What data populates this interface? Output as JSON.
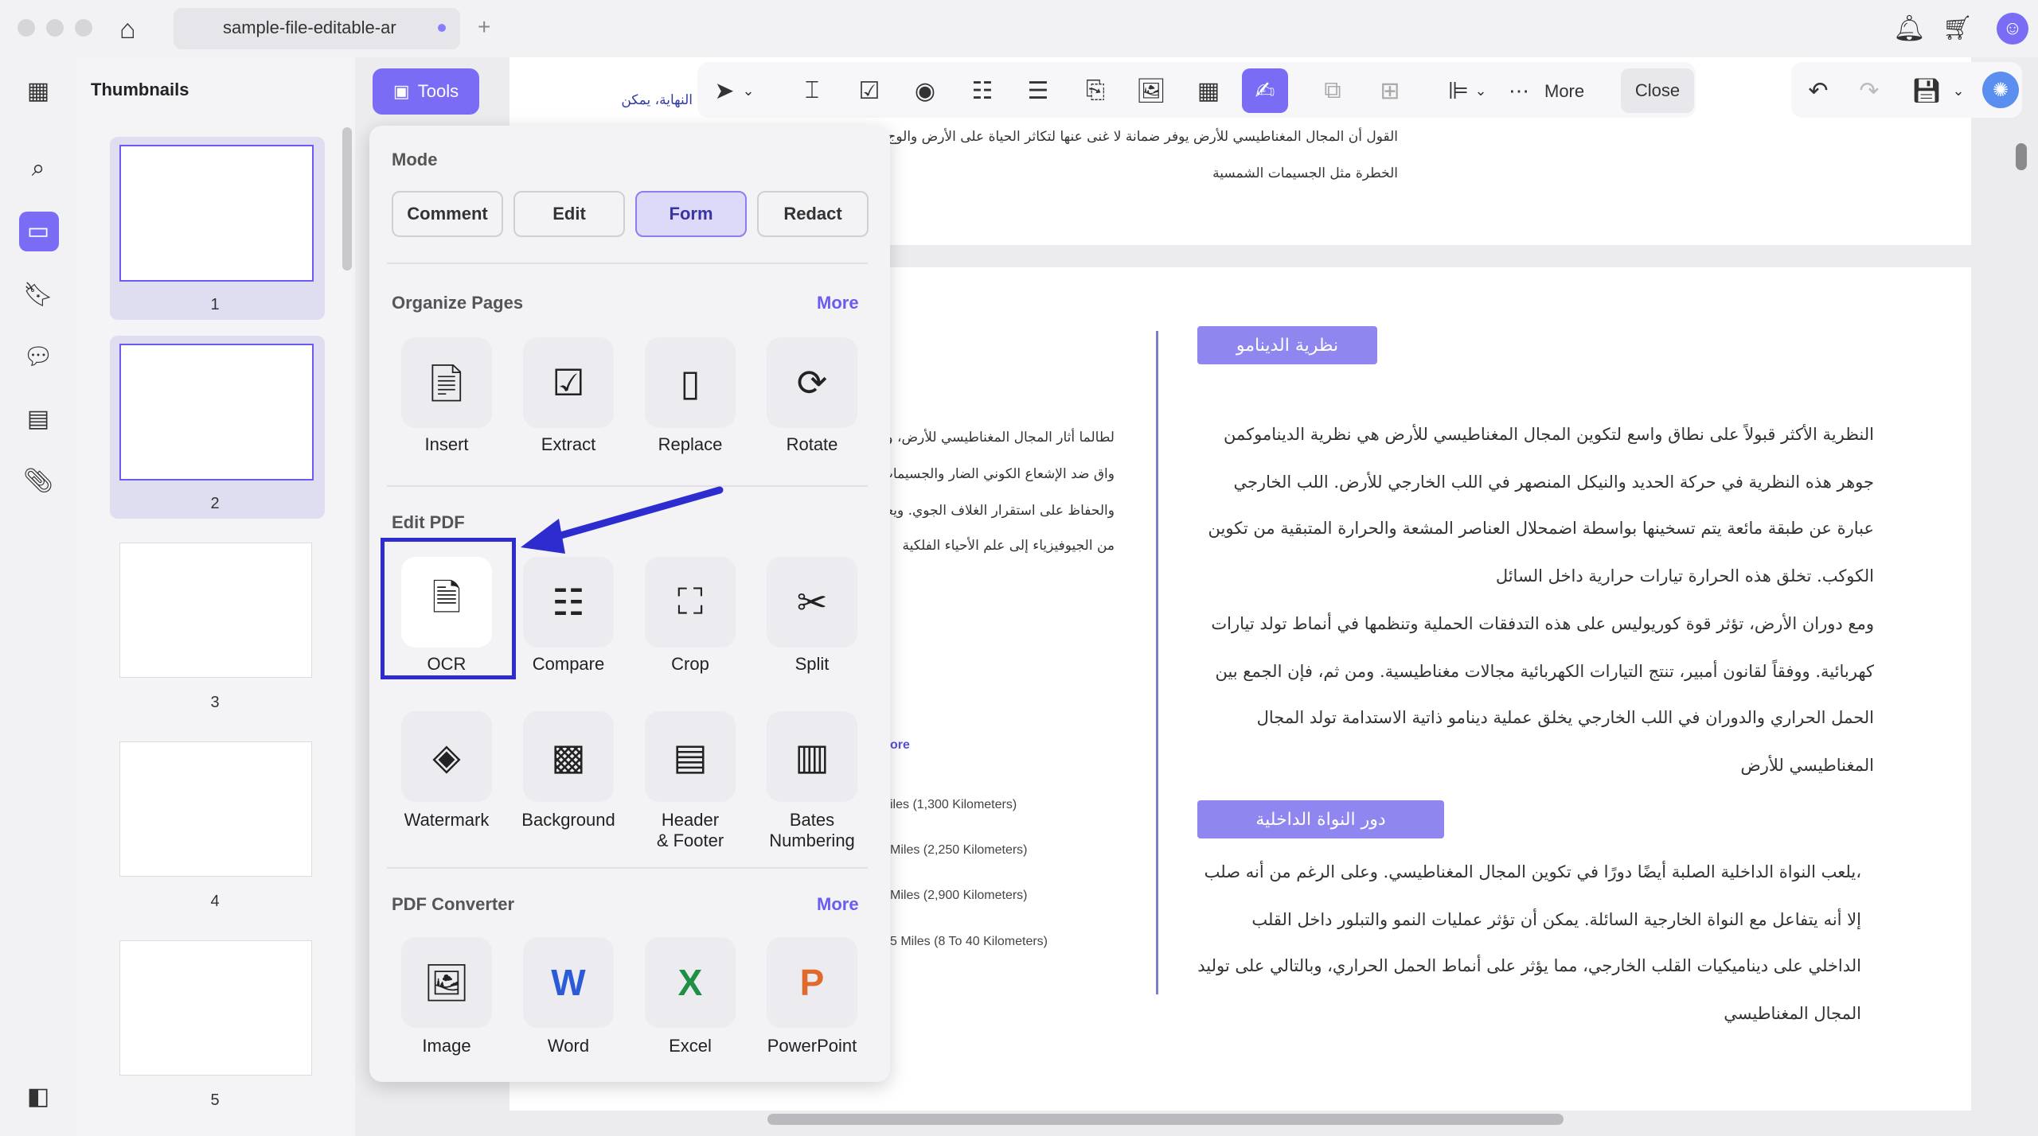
{
  "window": {
    "tab_title": "sample-file-editable-ar"
  },
  "sidebar": {
    "title": "Thumbnails",
    "pages": [
      "1",
      "2",
      "3",
      "4",
      "5"
    ]
  },
  "toolbar": {
    "tools_label": "Tools",
    "more_label": "More",
    "close_label": "Close"
  },
  "menu": {
    "mode_title": "Mode",
    "modes": [
      "Comment",
      "Edit",
      "Form",
      "Redact"
    ],
    "active_mode": "Form",
    "organize_title": "Organize Pages",
    "organize_more": "More",
    "organize_items": [
      "Insert",
      "Extract",
      "Replace",
      "Rotate"
    ],
    "edit_title": "Edit PDF",
    "edit_items": [
      "OCR",
      "Compare",
      "Crop",
      "Split"
    ],
    "edit_items2": [
      "Watermark",
      "Background",
      "Header\n& Footer",
      "Bates\nNumbering"
    ],
    "converter_title": "PDF Converter",
    "converter_more": "More",
    "converter_items": [
      "Image",
      "Word",
      "Excel",
      "PowerPoint"
    ]
  },
  "document": {
    "top_line_small": "النهاية، يمكن",
    "top_line1": "القول أن المجال المغناطيسي للأرض يوفر ضمانة لا غنى عنها لتكاثر الحياة على الأرض والوج",
    "top_line2": "الخطرة مثل الجسيمات الشمسية",
    "heading1": "نظرية الدينامو",
    "para1": [
      "النظرية الأكثر قبولاً على نطاق واسع لتكوين المجال المغناطيسي للأرض هي نظرية الديناموكمن",
      "جوهر هذه النظرية في حركة الحديد والنيكل المنصهر في اللب الخارجي للأرض. اللب الخارجي",
      "عبارة عن طبقة مائعة يتم تسخينها بواسطة اضمحلال العناصر المشعة والحرارة المتبقية من تكوين",
      "الكوكب. تخلق هذه الحرارة تيارات حرارية داخل السائل",
      "ومع دوران الأرض، تؤثر قوة كوريوليس على هذه التدفقات الحملية وتنظمها في أنماط تولد تيارات",
      "كهربائية. ووفقاً لقانون أمبير، تنتج التيارات الكهربائية مجالات مغناطيسية. ومن ثم، فإن الجمع بين",
      "الحمل الحراري والدوران في اللب الخارجي يخلق عملية دينامو ذاتية الاستدامة تولد المجال",
      "المغناطيسي للأرض"
    ],
    "heading2": "دور النواة الداخلية",
    "para2": [
      "،يلعب النواة الداخلية الصلبة أيضًا دورًا في تكوين المجال المغناطيسي. وعلى الرغم من أنه صلب",
      "إلا أنه يتفاعل مع النواة الخارجية السائلة. يمكن أن تؤثر عمليات النمو والتبلور داخل القلب",
      "الداخلي على ديناميكيات القلب الخارجي، مما يؤثر على أنماط الحمل الحراري، وبالتالي على توليد",
      "المجال المغناطيسي"
    ],
    "left_para": [
      "لطالما أثار المجال المغناطيسي للأرض، وه",
      "واق ضد الإشعاع الكوني الضار والجسيمات",
      "والحفاظ على استقرار الغلاف الجوي. ويعد",
      "من الجيوفيزياء إلى علم الأحياء الفلكية"
    ],
    "left_more": "ore",
    "left_miles": [
      "iles (1,300 Kilometers)",
      "Miles (2,250 Kilometers)",
      "Miles (2,900 Kilometers)",
      "5 Miles (8 To 40 Kilometers)"
    ]
  },
  "colors": {
    "accent": "#7a6cf5",
    "highlight_box": "#2c2ccf"
  }
}
